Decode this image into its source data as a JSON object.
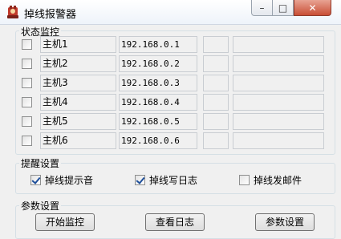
{
  "window": {
    "title": "掉线报警器",
    "icon": "alarm-app-icon"
  },
  "controls": {
    "minimize": "–",
    "maximize": "□",
    "close": "✕"
  },
  "monitor": {
    "title": "状态监控",
    "hosts": [
      {
        "name": "主机1",
        "ip": "192.168.0.1",
        "checked": false
      },
      {
        "name": "主机2",
        "ip": "192.168.0.2",
        "checked": false
      },
      {
        "name": "主机3",
        "ip": "192.168.0.3",
        "checked": false
      },
      {
        "name": "主机4",
        "ip": "192.168.0.4",
        "checked": false
      },
      {
        "name": "主机5",
        "ip": "192.168.0.5",
        "checked": false
      },
      {
        "name": "主机6",
        "ip": "192.168.0.6",
        "checked": false
      }
    ]
  },
  "reminder": {
    "title": "提醒设置",
    "options": [
      {
        "label": "掉线提示音",
        "checked": true
      },
      {
        "label": "掉线写日志",
        "checked": true
      },
      {
        "label": "掉线发邮件",
        "checked": false
      }
    ]
  },
  "params": {
    "title": "参数设置",
    "buttons": [
      "开始监控",
      "查看日志",
      "参数设置"
    ]
  }
}
